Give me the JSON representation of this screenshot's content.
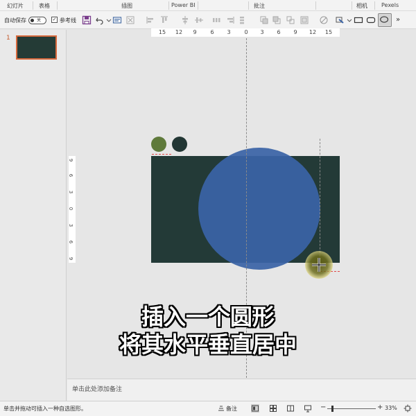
{
  "ribbon": {
    "groups": [
      "幻灯片",
      "表格",
      "插图",
      "Power BI",
      "批注",
      "相机",
      "Pexels"
    ]
  },
  "toolbar": {
    "autosave_label": "自动保存",
    "autosave_state": "关",
    "checkbox_mark": "✓",
    "guides_label": "参考线",
    "more_label": "»"
  },
  "slides_panel": {
    "slide_number": "1"
  },
  "rulers": {
    "horizontal": [
      "15",
      "12",
      "9",
      "6",
      "3",
      "0",
      "3",
      "6",
      "9",
      "12",
      "15"
    ],
    "vertical": [
      "9",
      "6",
      "3",
      "0",
      "3",
      "6",
      "9"
    ]
  },
  "colors": {
    "slide_bg": "#233a37",
    "circle_fill": "#3a63a6",
    "swatch_green": "#5f7a3b",
    "swatch_dark": "#223634",
    "thumb_border": "#d86a3d"
  },
  "caption": {
    "line1": "插入一个圆形",
    "line2": "将其水平垂直居中"
  },
  "notes": {
    "placeholder": "单击此处添加备注"
  },
  "status": {
    "hint": "单击并拖动可插入一种自选图形。",
    "notes_label": "备注",
    "zoom_minus": "−",
    "zoom_plus": "+",
    "zoom_value": "33%"
  }
}
